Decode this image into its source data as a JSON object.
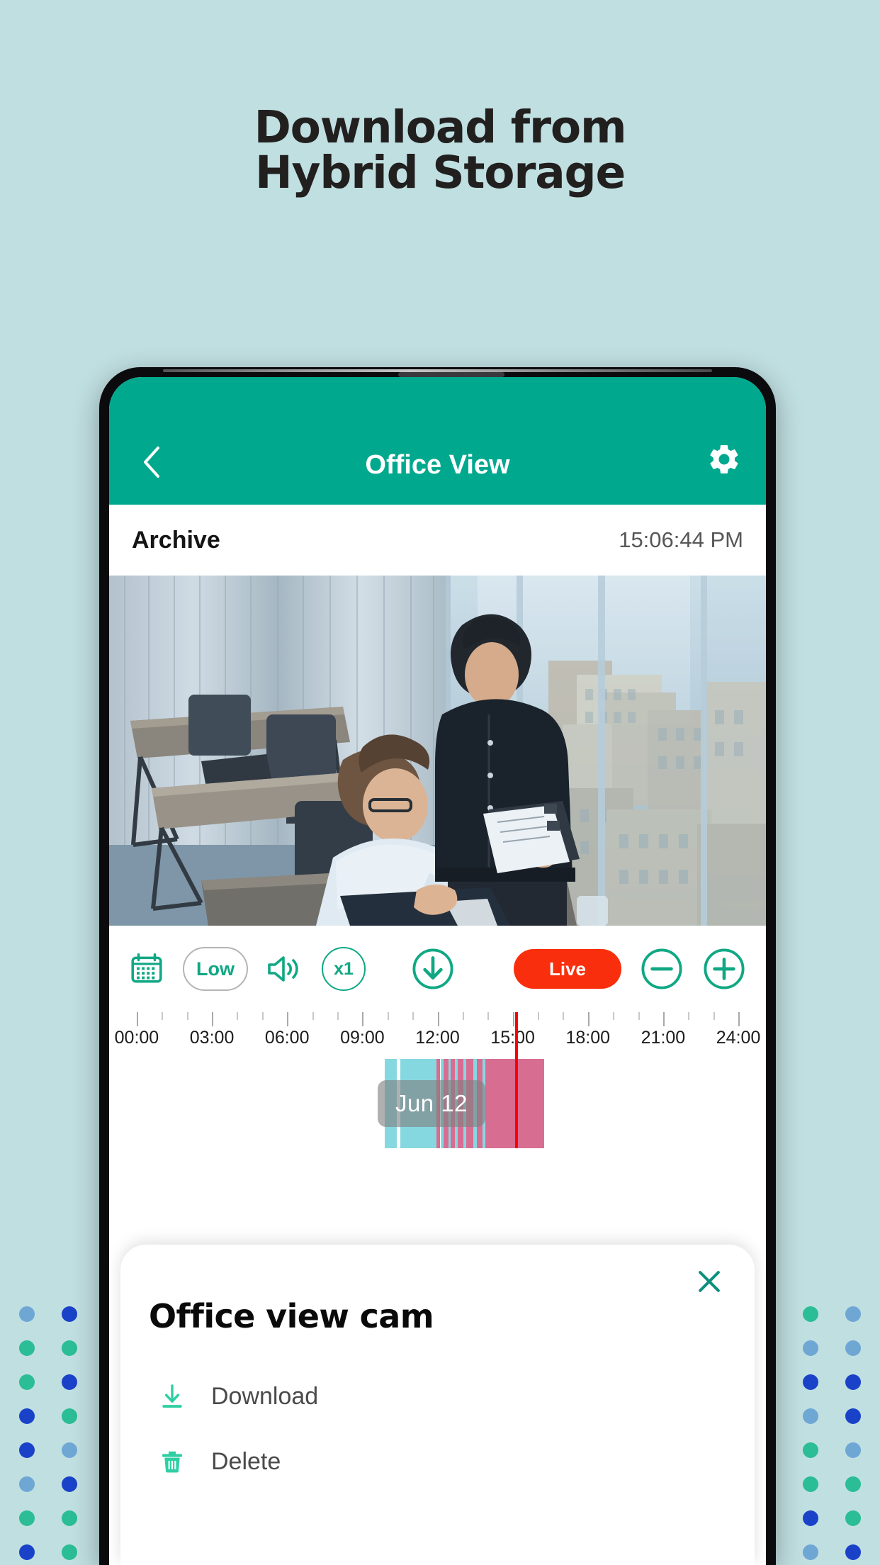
{
  "page": {
    "background_color": "#c0dfe1",
    "headline_line1": "Download from",
    "headline_line2": "Hybrid Storage"
  },
  "decor": {
    "dot_colors": [
      "#6fa7d4",
      "#1a42c8",
      "#2bbd95"
    ],
    "left_pattern": [
      [
        0,
        1,
        1
      ],
      [
        2,
        2,
        2
      ],
      [
        2,
        1,
        1
      ],
      [
        1,
        2,
        1
      ],
      [
        1,
        0,
        2
      ],
      [
        0,
        1,
        1
      ],
      [
        2,
        2,
        2
      ],
      [
        1,
        2,
        0
      ]
    ],
    "right_pattern": [
      [
        1,
        2,
        0
      ],
      [
        1,
        0,
        0
      ],
      [
        1,
        1,
        1
      ],
      [
        0,
        0,
        1
      ],
      [
        1,
        2,
        0
      ],
      [
        2,
        2,
        2
      ],
      [
        0,
        1,
        2
      ],
      [
        1,
        0,
        1
      ]
    ]
  },
  "app": {
    "header": {
      "title": "Office View",
      "back_icon": "chevron-left-icon",
      "settings_icon": "gear-icon",
      "bar_color": "#00a88e"
    },
    "archive_bar": {
      "label": "Archive",
      "timestamp": "15:06:44 PM"
    },
    "video": {
      "scene_description": "Office view camera feed"
    },
    "toolbar": {
      "calendar_icon": "calendar-icon",
      "quality_label": "Low",
      "volume_icon": "speaker-icon",
      "speed_label": "x1",
      "download_icon": "download-circle-icon",
      "live_label": "Live",
      "live_color": "#f92e0c",
      "zoom_out_icon": "minus-circle-icon",
      "zoom_in_icon": "plus-circle-icon",
      "accent_color": "#10a884"
    },
    "timeline": {
      "tick_labels": [
        "00:00",
        "03:00",
        "06:00",
        "09:00",
        "12:00",
        "15:00",
        "18:00",
        "21:00",
        "24:00"
      ],
      "day_chip": "Jun 12",
      "playhead_time": "15:06",
      "playhead_color": "#fb0000",
      "segments": [
        {
          "start_pct": 41.2,
          "width_pct": 2.0,
          "color": "#86d8e0"
        },
        {
          "start_pct": 43.8,
          "width_pct": 6.0,
          "color": "#86d8e0"
        },
        {
          "start_pct": 49.8,
          "width_pct": 0.6,
          "color": "#d86d92"
        },
        {
          "start_pct": 50.5,
          "width_pct": 0.5,
          "color": "#86d8e0"
        },
        {
          "start_pct": 51.0,
          "width_pct": 0.8,
          "color": "#d86d92"
        },
        {
          "start_pct": 51.8,
          "width_pct": 0.4,
          "color": "#86d8e0"
        },
        {
          "start_pct": 52.2,
          "width_pct": 0.7,
          "color": "#d86d92"
        },
        {
          "start_pct": 52.9,
          "width_pct": 0.5,
          "color": "#86d8e0"
        },
        {
          "start_pct": 53.4,
          "width_pct": 0.9,
          "color": "#d86d92"
        },
        {
          "start_pct": 54.3,
          "width_pct": 0.5,
          "color": "#86d8e0"
        },
        {
          "start_pct": 54.8,
          "width_pct": 1.2,
          "color": "#d86d92"
        },
        {
          "start_pct": 56.0,
          "width_pct": 0.5,
          "color": "#86d8e0"
        },
        {
          "start_pct": 56.5,
          "width_pct": 1.0,
          "color": "#d86d92"
        },
        {
          "start_pct": 57.5,
          "width_pct": 0.4,
          "color": "#86d8e0"
        },
        {
          "start_pct": 57.9,
          "width_pct": 9.8,
          "color": "#d86d92"
        }
      ]
    },
    "sheet": {
      "title": "Office view cam",
      "close_icon": "close-icon",
      "items": [
        {
          "label": "Download",
          "icon": "download-icon"
        },
        {
          "label": "Delete",
          "icon": "trash-icon"
        }
      ]
    }
  }
}
